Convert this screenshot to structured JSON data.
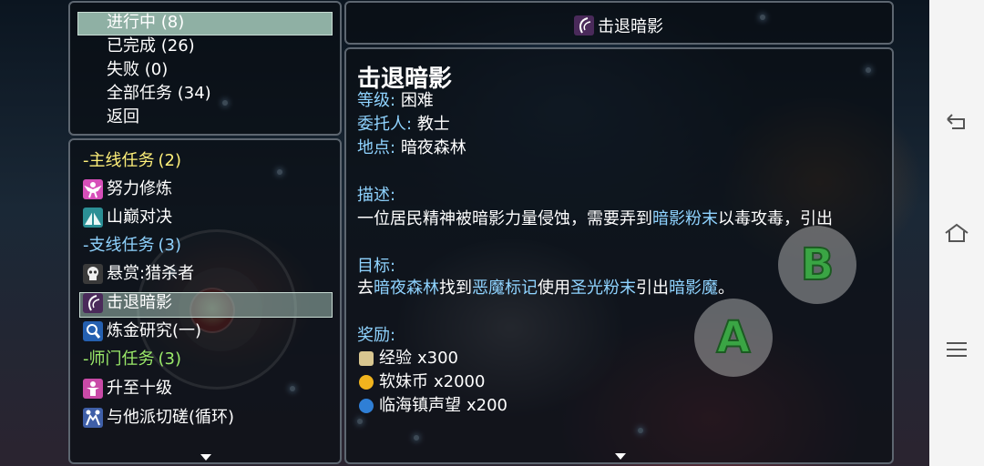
{
  "menu": {
    "items": [
      {
        "label": "进行中",
        "count": "(8)"
      },
      {
        "label": "已完成",
        "count": "(26)"
      },
      {
        "label": "失败",
        "count": "(0)"
      },
      {
        "label": "全部任务",
        "count": "(34)"
      },
      {
        "label": "返回",
        "count": ""
      }
    ],
    "selected_index": 0
  },
  "quest_list": {
    "rows": [
      {
        "kind": "category",
        "label": "-主线任务",
        "count": "(2)"
      },
      {
        "kind": "quest",
        "label": "努力修炼",
        "icon": "training-icon"
      },
      {
        "kind": "quest",
        "label": "山巅对决",
        "icon": "mountain-duel-icon"
      },
      {
        "kind": "category",
        "label": "-支线任务",
        "count": "(3)"
      },
      {
        "kind": "quest",
        "label": "悬赏:猎杀者",
        "icon": "skull-icon"
      },
      {
        "kind": "quest",
        "label": "击退暗影",
        "icon": "shadow-claw-icon"
      },
      {
        "kind": "quest",
        "label": "炼金研究(一)",
        "icon": "magnifier-icon"
      },
      {
        "kind": "category",
        "label": "-师门任务",
        "count": "(3)"
      },
      {
        "kind": "quest",
        "label": "升至十级",
        "icon": "level-up-icon"
      },
      {
        "kind": "quest",
        "label": "与他派切磋(循环)",
        "icon": "spar-icon"
      }
    ],
    "selected_index": 5
  },
  "detail": {
    "header_title": "击退暗影",
    "name": "击退暗影",
    "difficulty_label": "等级:",
    "difficulty": "困难",
    "client_label": "委托人:",
    "client": "教士",
    "location_label": "地点:",
    "location": "暗夜森林",
    "description_label": "描述:",
    "description": {
      "part1": "一位居民精神被暗影力量侵蚀，需要弄到",
      "item": "暗影粉末",
      "part2": "以毒攻毒，引出"
    },
    "objective_label": "目标:",
    "objective": {
      "p1": "去",
      "place": "暗夜森林",
      "p2": "找到",
      "item1": "恶魔标记",
      "p3": "使用",
      "item2": "圣光粉末",
      "p4": "引出",
      "boss": "暗影魔",
      "p5": "。"
    },
    "reward_label": "奖励:",
    "rewards": [
      {
        "icon": "scroll-icon",
        "label": "经验",
        "amount": "x300"
      },
      {
        "icon": "coins-icon",
        "label": "软妹币",
        "amount": "x2000"
      },
      {
        "icon": "reputation-icon",
        "label": "临海镇声望",
        "amount": "x200"
      }
    ]
  },
  "controls": {
    "button_a": "A",
    "button_b": "B"
  },
  "colors": {
    "category_main": "#fff07a",
    "category_side": "#8fd3ff",
    "category_master": "#9cec6a",
    "highlight": "#8fd3ff",
    "selection": "#8fb0a4"
  }
}
